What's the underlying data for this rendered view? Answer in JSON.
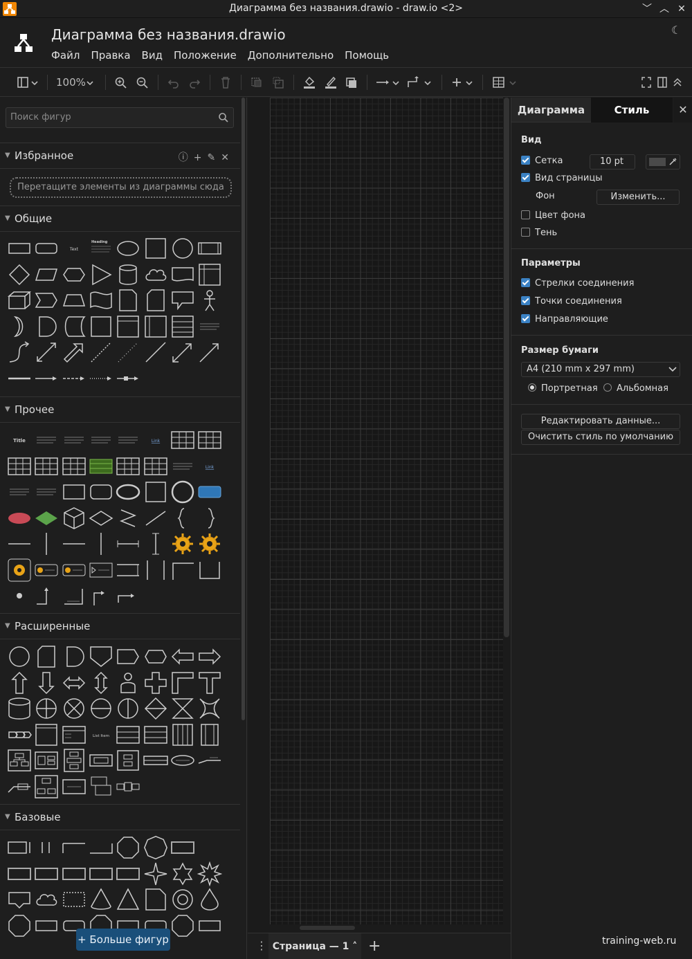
{
  "window": {
    "title": "Диаграмма без названия.drawio - draw.io <2>",
    "minimize": "﹀",
    "maximize": "︿",
    "close": "✕"
  },
  "header": {
    "doc_title": "Диаграмма без названия.drawio",
    "menu": [
      "Файл",
      "Правка",
      "Вид",
      "Положение",
      "Дополнительно",
      "Помощь"
    ],
    "theme_icon": "☾"
  },
  "toolbar": {
    "zoom": "100%",
    "icons": [
      "format-panel-icon",
      "zoom-in-icon",
      "zoom-out-icon",
      "undo-icon",
      "redo-icon",
      "delete-icon",
      "to-front-icon",
      "to-back-icon",
      "fill-color-icon",
      "line-color-icon",
      "shadow-icon",
      "connection-icon",
      "waypoints-icon",
      "insert-icon",
      "table-icon",
      "fullscreen-icon",
      "format-toggle-icon",
      "collapse-icon"
    ]
  },
  "left_panel": {
    "search_placeholder": "Поиск фигур",
    "sections": {
      "favorites": "Избранное",
      "general": "Общие",
      "misc": "Прочее",
      "advanced": "Расширенные",
      "basic": "Базовые"
    },
    "favorites_drop": "Перетащите элементы из диаграммы сюда",
    "more_shapes": "+ Больше фигур"
  },
  "pagebar": {
    "menu_icon": "⋮",
    "page_tab": "Страница — 1 ˄",
    "add_icon": "+"
  },
  "right_panel": {
    "tabs": [
      "Диаграмма",
      "Стиль"
    ],
    "close": "✕",
    "view": {
      "heading": "Вид",
      "grid": "Сетка",
      "grid_size": "10 pt",
      "page_view": "Вид страницы",
      "background": "Фон",
      "change": "Изменить...",
      "bg_color": "Цвет фона",
      "shadow": "Тень"
    },
    "options": {
      "heading": "Параметры",
      "arrows": "Стрелки соединения",
      "points": "Точки соединения",
      "guides": "Направляющие"
    },
    "paper": {
      "heading": "Размер бумаги",
      "size": "A4 (210 mm x 297 mm)",
      "portrait": "Портретная",
      "landscape": "Альбомная"
    },
    "edit_data": "Редактировать данные...",
    "clear_style": "Очистить стиль по умолчанию"
  },
  "watermark": "training-web.ru",
  "colors": {
    "accent": "#3b82c4",
    "more_shapes_bg": "#1a4f7a",
    "logo": "#f08705"
  }
}
